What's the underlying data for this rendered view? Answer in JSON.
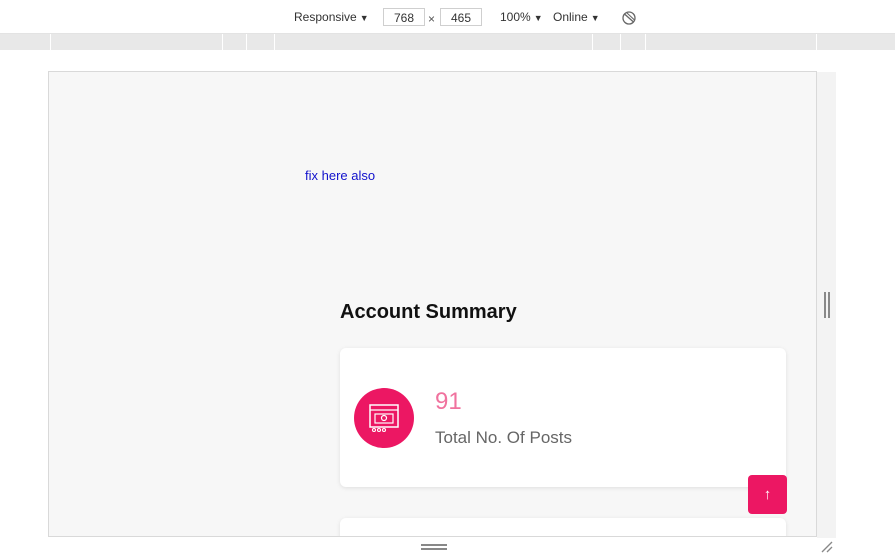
{
  "toolbar": {
    "device": "Responsive",
    "width": "768",
    "height": "465",
    "times": "×",
    "zoom": "100%",
    "throttle": "Online",
    "dropdown_arrow": "▼"
  },
  "page": {
    "fix_link": "fix here also",
    "section_title": "Account Summary",
    "posts_count": "91",
    "posts_label": "Total No. Of Posts",
    "scroll_top_icon": "↑",
    "accent_color": "#ec1763",
    "count_color": "#f0729e"
  }
}
